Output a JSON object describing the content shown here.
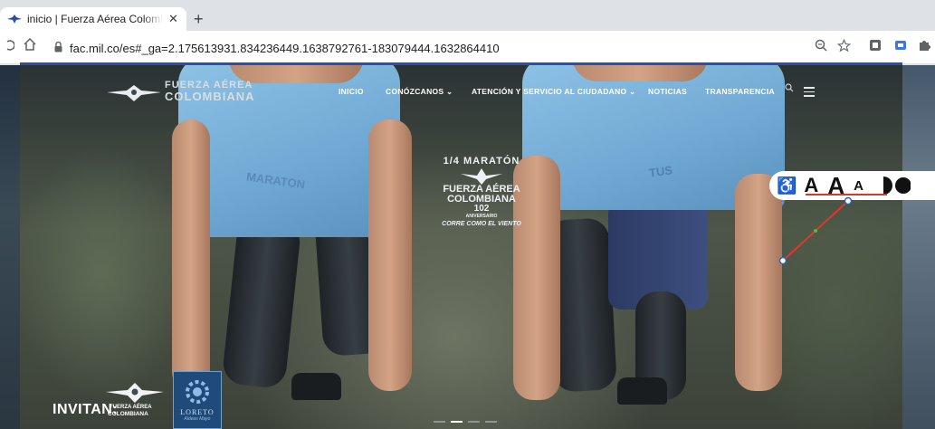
{
  "browser": {
    "tab": {
      "title": "inicio | Fuerza Aérea Colombia",
      "close_glyph": "✕"
    },
    "new_tab_glyph": "+",
    "url": "fac.mil.co/es#_ga=2.175613931.834236449.1638792761-183079444.1632864410",
    "icons": [
      "reload-icon",
      "home-icon",
      "lock-icon",
      "zoom-icon",
      "star-icon",
      "extension-icon",
      "translate-icon",
      "puzzle-icon"
    ],
    "accent_color": "#2b4fa8"
  },
  "site": {
    "brand_top": "FUERZA AÉREA",
    "brand_bottom": "COLOMBIANA",
    "nav": [
      {
        "label": "INICIO"
      },
      {
        "label": "CONÓZCANOS ⌄"
      },
      {
        "label": "ATENCIÓN Y SERVICIO AL CIUDADANO ⌄"
      },
      {
        "label": "NOTICIAS"
      },
      {
        "label": "TRANSPARENCIA"
      }
    ],
    "emblem": {
      "line1": "1/4 MARATÓN",
      "line2": "FUERZA AÉREA",
      "line3": "COLOMBIANA",
      "line4": "102",
      "line5": "ANIVERSARIO",
      "line6": "CORRE COMO EL VIENTO"
    },
    "shirt_text_left": "MARATON",
    "shirt_text_right": "TUS",
    "accessibility": {
      "large": "A",
      "medium": "A",
      "small": "A",
      "underline_color": "#d23a2a"
    },
    "invitan": "INVITAN:",
    "sponsor_fac_line1": "FUERZA AÉREA",
    "sponsor_fac_line2": "COLOMBIANA",
    "sponsor_loreto_name": "LORETO",
    "sponsor_loreto_sub": "Aldeas Mayo",
    "slides": {
      "count": 4,
      "active": 1
    }
  }
}
